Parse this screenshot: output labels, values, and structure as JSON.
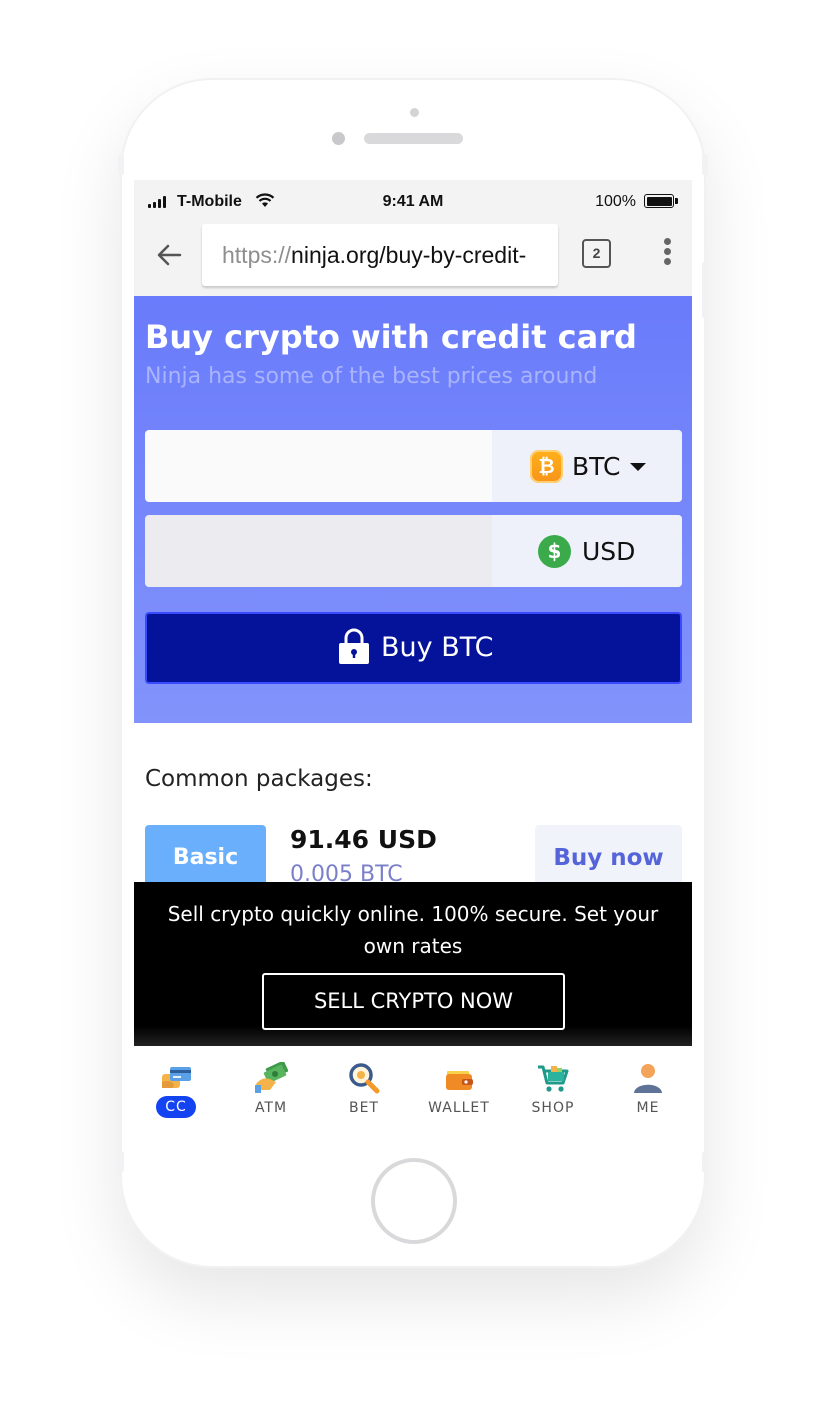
{
  "status_bar": {
    "carrier": "T-Mobile",
    "time": "9:41 AM",
    "battery": "100%"
  },
  "browser": {
    "url_scheme": "https://",
    "url_rest": "ninja.org/buy-by-credit-",
    "tab_count": "2"
  },
  "hero": {
    "title": "Buy crypto with credit card",
    "subtitle": "Ninja has some of the best prices around"
  },
  "form": {
    "crypto_currency": "BTC",
    "fiat_currency": "USD",
    "btc_coin_glyph": "₿",
    "usd_coin_glyph": "$",
    "buy_button": "Buy BTC"
  },
  "packages": {
    "label": "Common packages:",
    "items": [
      {
        "name": "Basic",
        "price": "91.46 USD",
        "btc": "0.005 BTC",
        "action": "Buy now"
      }
    ]
  },
  "sell_banner": {
    "text": "Sell crypto quickly online. 100% secure. Set your own rates",
    "button": "SELL CRYPTO NOW"
  },
  "tabbar": {
    "items": [
      {
        "label": "CC",
        "icon": "credit-card-icon",
        "active": true
      },
      {
        "label": "ATM",
        "icon": "cash-hand-icon",
        "active": false
      },
      {
        "label": "BET",
        "icon": "magnifier-icon",
        "active": false
      },
      {
        "label": "WALLET",
        "icon": "wallet-icon",
        "active": false
      },
      {
        "label": "SHOP",
        "icon": "shopping-cart-icon",
        "active": false
      },
      {
        "label": "ME",
        "icon": "user-icon",
        "active": false
      }
    ]
  },
  "colors": {
    "hero_top": "#6a7bfb",
    "hero_bottom": "#8293fb",
    "buy_button": "#05129a",
    "active_tab": "#1443f2",
    "package_badge": "#6aaffb"
  }
}
